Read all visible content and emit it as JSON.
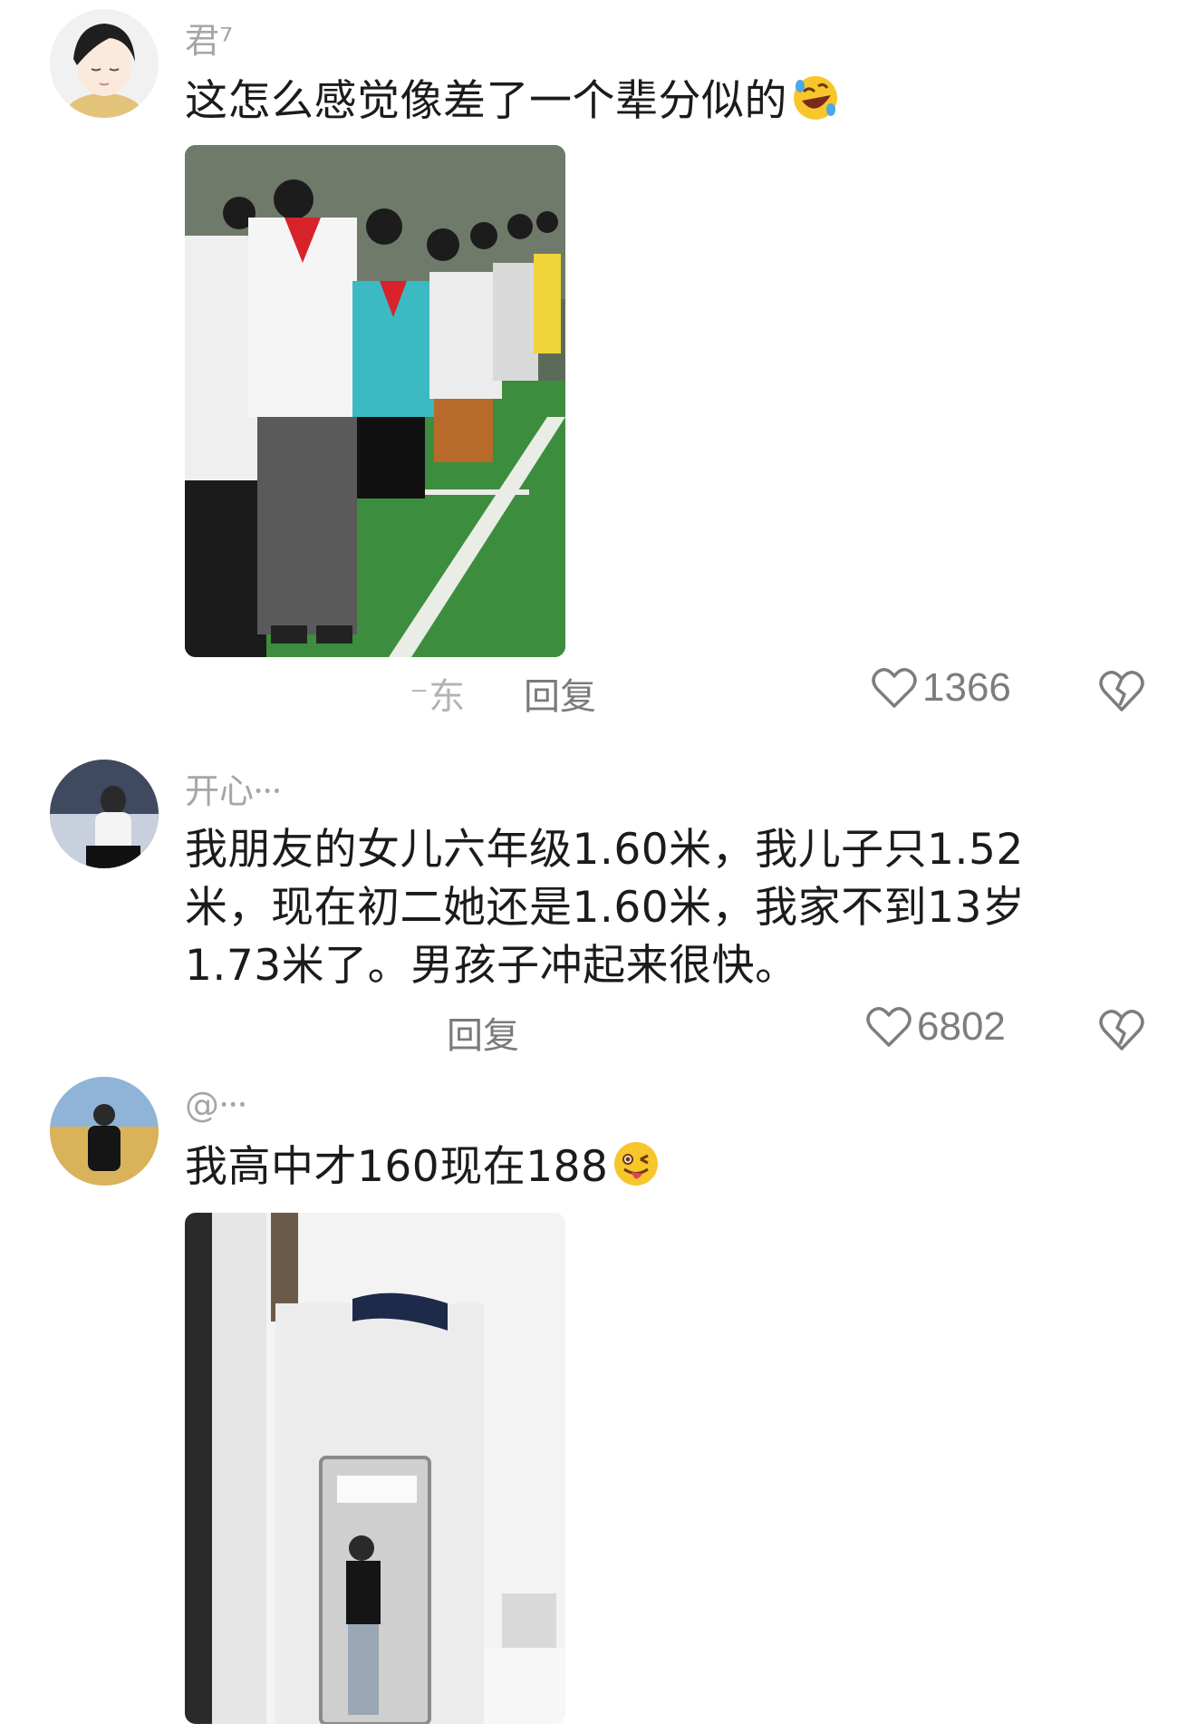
{
  "comments": [
    {
      "username": "君⁷",
      "text": "这怎么感觉像差了一个辈分似的",
      "emoji": "rolling-on-floor-laughing",
      "location": "⁻东",
      "reply_label": "回复",
      "likes": "1366"
    },
    {
      "username": "开心⸱⸱⸱",
      "text": "我朋友的女儿六年级1.60米，我儿子只1.52米，现在初二她还是1.60米，我家不到13岁1.73米了。男孩子冲起来很快。",
      "reply_label": "回复",
      "likes": "6802"
    },
    {
      "username": "@⸱⸱⸱",
      "text": "我高中才160现在188",
      "emoji": "winking-face-with-tongue"
    }
  ],
  "colors": {
    "username": "#a6a6a6",
    "text": "#1b1b1b",
    "meta": "#7a7a7a",
    "emoji_yellow": "#f7c62b",
    "scarf_red": "#d8232a",
    "field_green": "#3d8d3e"
  }
}
